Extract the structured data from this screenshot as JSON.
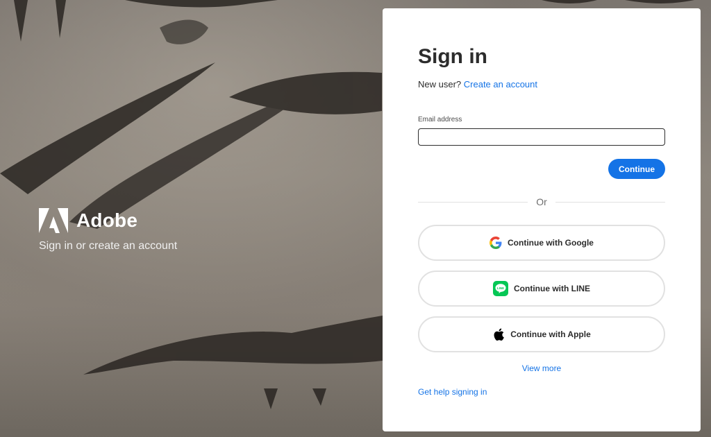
{
  "brand": {
    "name": "Adobe",
    "tagline": "Sign in or create an account"
  },
  "signin": {
    "title": "Sign in",
    "new_user_text": "New user?",
    "create_account_link": "Create an account",
    "email_label": "Email address",
    "email_value": "",
    "continue_label": "Continue",
    "or_text": "Or",
    "social": {
      "google": "Continue with Google",
      "line": "Continue with LINE",
      "apple": "Continue with Apple"
    },
    "view_more": "View more",
    "help_link": "Get help signing in"
  },
  "colors": {
    "accent": "#1473e6",
    "line_green": "#06c755",
    "text": "#2c2c2c"
  },
  "icons": [
    "adobe-logo-icon",
    "google-icon",
    "line-icon",
    "apple-icon"
  ]
}
